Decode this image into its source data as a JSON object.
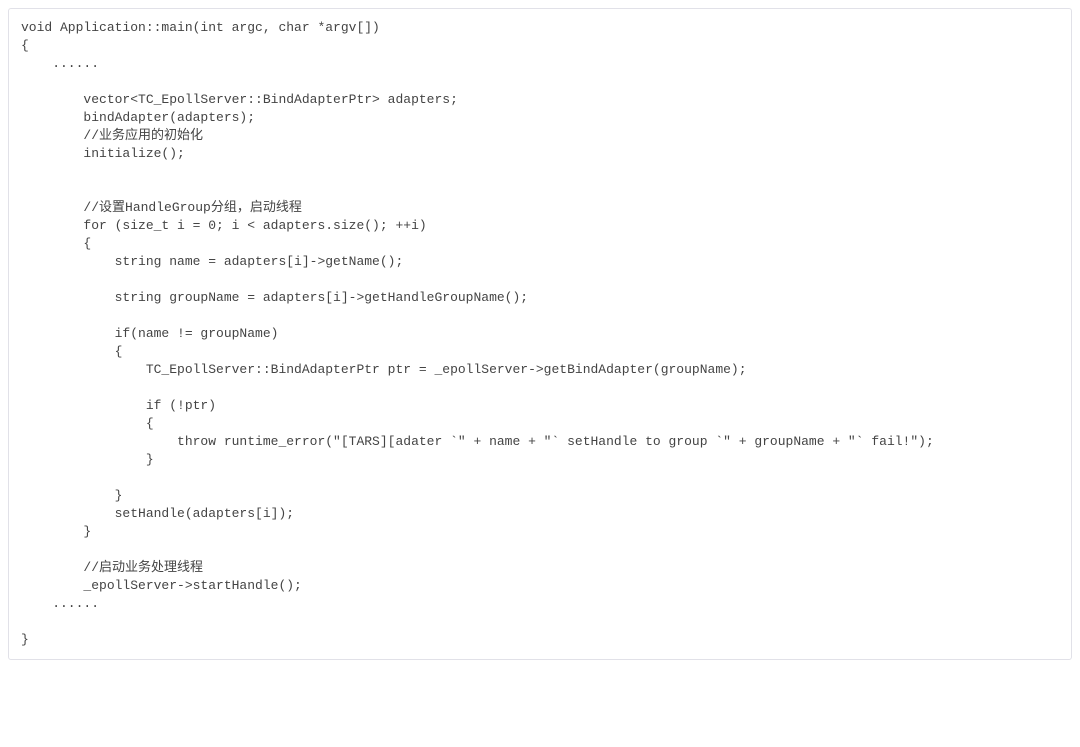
{
  "code": {
    "language": "cpp",
    "lines": [
      {
        "indent": 0,
        "text": "void Application::main(int argc, char *argv[])"
      },
      {
        "indent": 0,
        "text": "{"
      },
      {
        "indent": 1,
        "text": "......"
      },
      {
        "indent": 0,
        "text": ""
      },
      {
        "indent": 2,
        "text": "vector<TC_EpollServer::BindAdapterPtr> adapters;"
      },
      {
        "indent": 2,
        "text": "bindAdapter(adapters);"
      },
      {
        "indent": 2,
        "text": "//业务应用的初始化"
      },
      {
        "indent": 2,
        "text": "initialize();"
      },
      {
        "indent": 0,
        "text": ""
      },
      {
        "indent": 0,
        "text": ""
      },
      {
        "indent": 2,
        "text": "//设置HandleGroup分组，启动线程"
      },
      {
        "indent": 2,
        "text": "for (size_t i = 0; i < adapters.size(); ++i)"
      },
      {
        "indent": 2,
        "text": "{"
      },
      {
        "indent": 3,
        "text": "string name = adapters[i]->getName();"
      },
      {
        "indent": 0,
        "text": ""
      },
      {
        "indent": 3,
        "text": "string groupName = adapters[i]->getHandleGroupName();"
      },
      {
        "indent": 0,
        "text": ""
      },
      {
        "indent": 3,
        "text": "if(name != groupName)"
      },
      {
        "indent": 3,
        "text": "{"
      },
      {
        "indent": 4,
        "text": "TC_EpollServer::BindAdapterPtr ptr = _epollServer->getBindAdapter(groupName);"
      },
      {
        "indent": 0,
        "text": ""
      },
      {
        "indent": 4,
        "text": "if (!ptr)"
      },
      {
        "indent": 4,
        "text": "{"
      },
      {
        "indent": 5,
        "text": "throw runtime_error(\"[TARS][adater `\" + name + \"` setHandle to group `\" + groupName + \"` fail!\");"
      },
      {
        "indent": 4,
        "text": "}"
      },
      {
        "indent": 0,
        "text": ""
      },
      {
        "indent": 3,
        "text": "}"
      },
      {
        "indent": 3,
        "text": "setHandle(adapters[i]);"
      },
      {
        "indent": 2,
        "text": "}"
      },
      {
        "indent": 0,
        "text": ""
      },
      {
        "indent": 2,
        "text": "//启动业务处理线程"
      },
      {
        "indent": 2,
        "text": "_epollServer->startHandle();"
      },
      {
        "indent": 1,
        "text": "......"
      },
      {
        "indent": 0,
        "text": ""
      },
      {
        "indent": 0,
        "text": "}"
      }
    ]
  }
}
